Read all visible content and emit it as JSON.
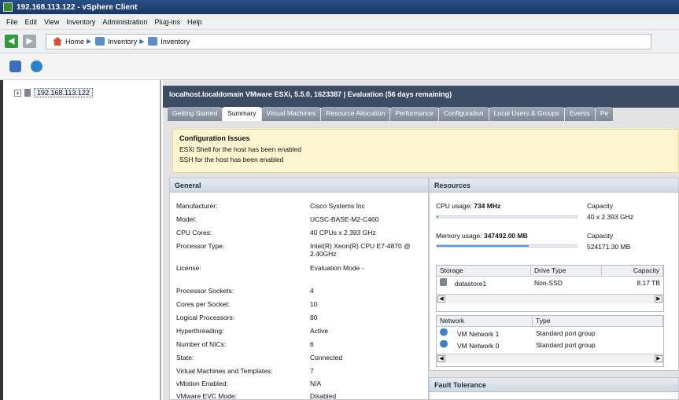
{
  "window": {
    "title": "192.168.113.122 - vSphere Client"
  },
  "menu": [
    "File",
    "Edit",
    "View",
    "Inventory",
    "Administration",
    "Plug-ins",
    "Help"
  ],
  "breadcrumb": {
    "home": "Home",
    "items": [
      "Inventory",
      "Inventory"
    ]
  },
  "tree": {
    "host": "192.168.113.122",
    "expander": "+"
  },
  "host_header": "localhost.localdomain VMware ESXi, 5.5.0, 1623387 | Evaluation (56 days remaining)",
  "tabs": [
    "Getting Started",
    "Summary",
    "Virtual Machines",
    "Resource Allocation",
    "Performance",
    "Configuration",
    "Local Users & Groups",
    "Events",
    "Pe"
  ],
  "active_tab": "Summary",
  "config_issues": {
    "title": "Configuration Issues",
    "messages": [
      "ESXi Shell for the host has been enabled",
      "SSH for the host has been enabled"
    ]
  },
  "general": {
    "title": "General",
    "rows": [
      {
        "k": "Manufacturer:",
        "v": "Cisco Systems Inc"
      },
      {
        "k": "Model:",
        "v": "UCSC-BASE-M2-C460"
      },
      {
        "k": "CPU Cores:",
        "v": "40 CPUs x 2.393 GHz"
      },
      {
        "k": "Processor Type:",
        "v": "Intel(R) Xeon(R) CPU E7-4870 @ 2.40GHz"
      },
      {
        "k": "License:",
        "v": "Evaluation Mode -"
      },
      {
        "k": "Processor Sockets:",
        "v": "4"
      },
      {
        "k": "Cores per Socket:",
        "v": "10"
      },
      {
        "k": "Logical Processors:",
        "v": "80"
      },
      {
        "k": "Hyperthreading:",
        "v": "Active"
      },
      {
        "k": "Number of NICs:",
        "v": "6"
      },
      {
        "k": "State:",
        "v": "Connected"
      },
      {
        "k": "Virtual Machines and Templates:",
        "v": "7"
      },
      {
        "k": "vMotion Enabled:",
        "v": "N/A"
      },
      {
        "k": "VMware EVC Mode:",
        "v": "Disabled"
      }
    ]
  },
  "resources": {
    "title": "Resources",
    "cpu_label": "CPU usage:",
    "cpu_value": "734 MHz",
    "cpu_capacity_label": "Capacity",
    "cpu_capacity": "40 x 2.393 GHz",
    "cpu_fraction": 0.01,
    "mem_label": "Memory usage:",
    "mem_value": "347492.00 MB",
    "mem_capacity_label": "Capacity",
    "mem_capacity": "524171.30 MB",
    "mem_fraction": 0.66,
    "storage": {
      "headers": [
        "Storage",
        "Drive Type",
        "Capacity"
      ],
      "rows": [
        {
          "name": "datastore1",
          "type": "Non-SSD",
          "capacity": "8.17 TB"
        }
      ]
    },
    "network": {
      "headers": [
        "Network",
        "Type"
      ],
      "rows": [
        {
          "name": "VM Network 1",
          "type": "Standard port group"
        },
        {
          "name": "VM Network 0",
          "type": "Standard port group"
        }
      ]
    }
  },
  "fault_tolerance": {
    "title": "Fault Tolerance"
  }
}
